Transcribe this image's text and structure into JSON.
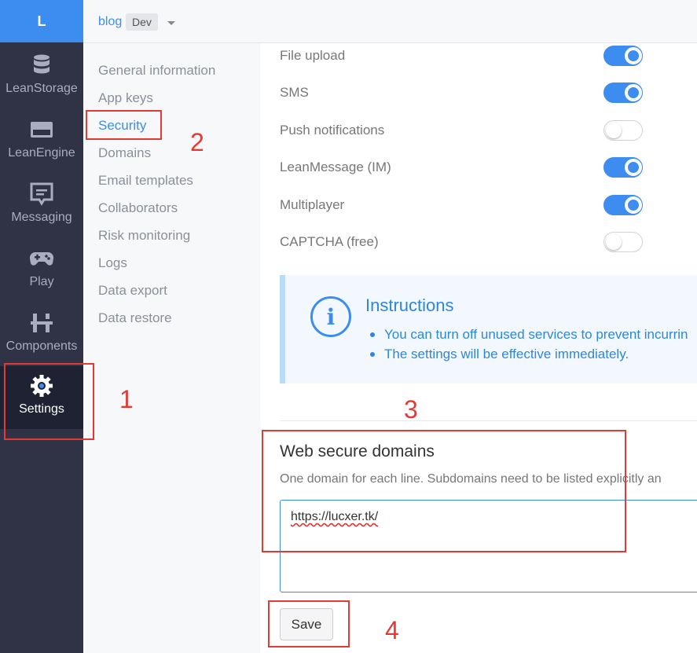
{
  "logo": {
    "letter": "L"
  },
  "sidebar": {
    "items": [
      {
        "label": "LeanStorage",
        "icon": "database-icon"
      },
      {
        "label": "LeanEngine",
        "icon": "server-icon"
      },
      {
        "label": "Messaging",
        "icon": "message-icon"
      },
      {
        "label": "Play",
        "icon": "gamepad-icon"
      },
      {
        "label": "Components",
        "icon": "sliders-icon"
      },
      {
        "label": "Settings",
        "icon": "gear-icon",
        "active": true
      }
    ]
  },
  "topbar": {
    "app_name": "blog",
    "env": "Dev"
  },
  "subnav": {
    "items": [
      {
        "label": "General information"
      },
      {
        "label": "App keys"
      },
      {
        "label": "Security",
        "active": true
      },
      {
        "label": "Domains"
      },
      {
        "label": "Email templates"
      },
      {
        "label": "Collaborators"
      },
      {
        "label": "Risk monitoring"
      },
      {
        "label": "Logs"
      },
      {
        "label": "Data export"
      },
      {
        "label": "Data restore"
      }
    ]
  },
  "services": [
    {
      "label": "File upload",
      "enabled": true
    },
    {
      "label": "SMS",
      "enabled": true
    },
    {
      "label": "Push notifications",
      "enabled": false
    },
    {
      "label": "LeanMessage (IM)",
      "enabled": true
    },
    {
      "label": "Multiplayer",
      "enabled": true
    },
    {
      "label": "CAPTCHA (free)",
      "enabled": false
    }
  ],
  "instructions": {
    "title": "Instructions",
    "items": [
      "You can turn off unused services to prevent incurrin",
      "The settings will be effective immediately."
    ]
  },
  "web_domains": {
    "title": "Web secure domains",
    "description": "One domain for each line. Subdomains need to be listed explicitly an",
    "value": "https://lucxer.tk/",
    "save_label": "Save"
  },
  "annotations": {
    "one": "1",
    "two": "2",
    "three": "3",
    "four": "4",
    "color": "#e53935"
  },
  "colors": {
    "accent": "#3d8cf0",
    "sidebar": "#2f3345"
  }
}
